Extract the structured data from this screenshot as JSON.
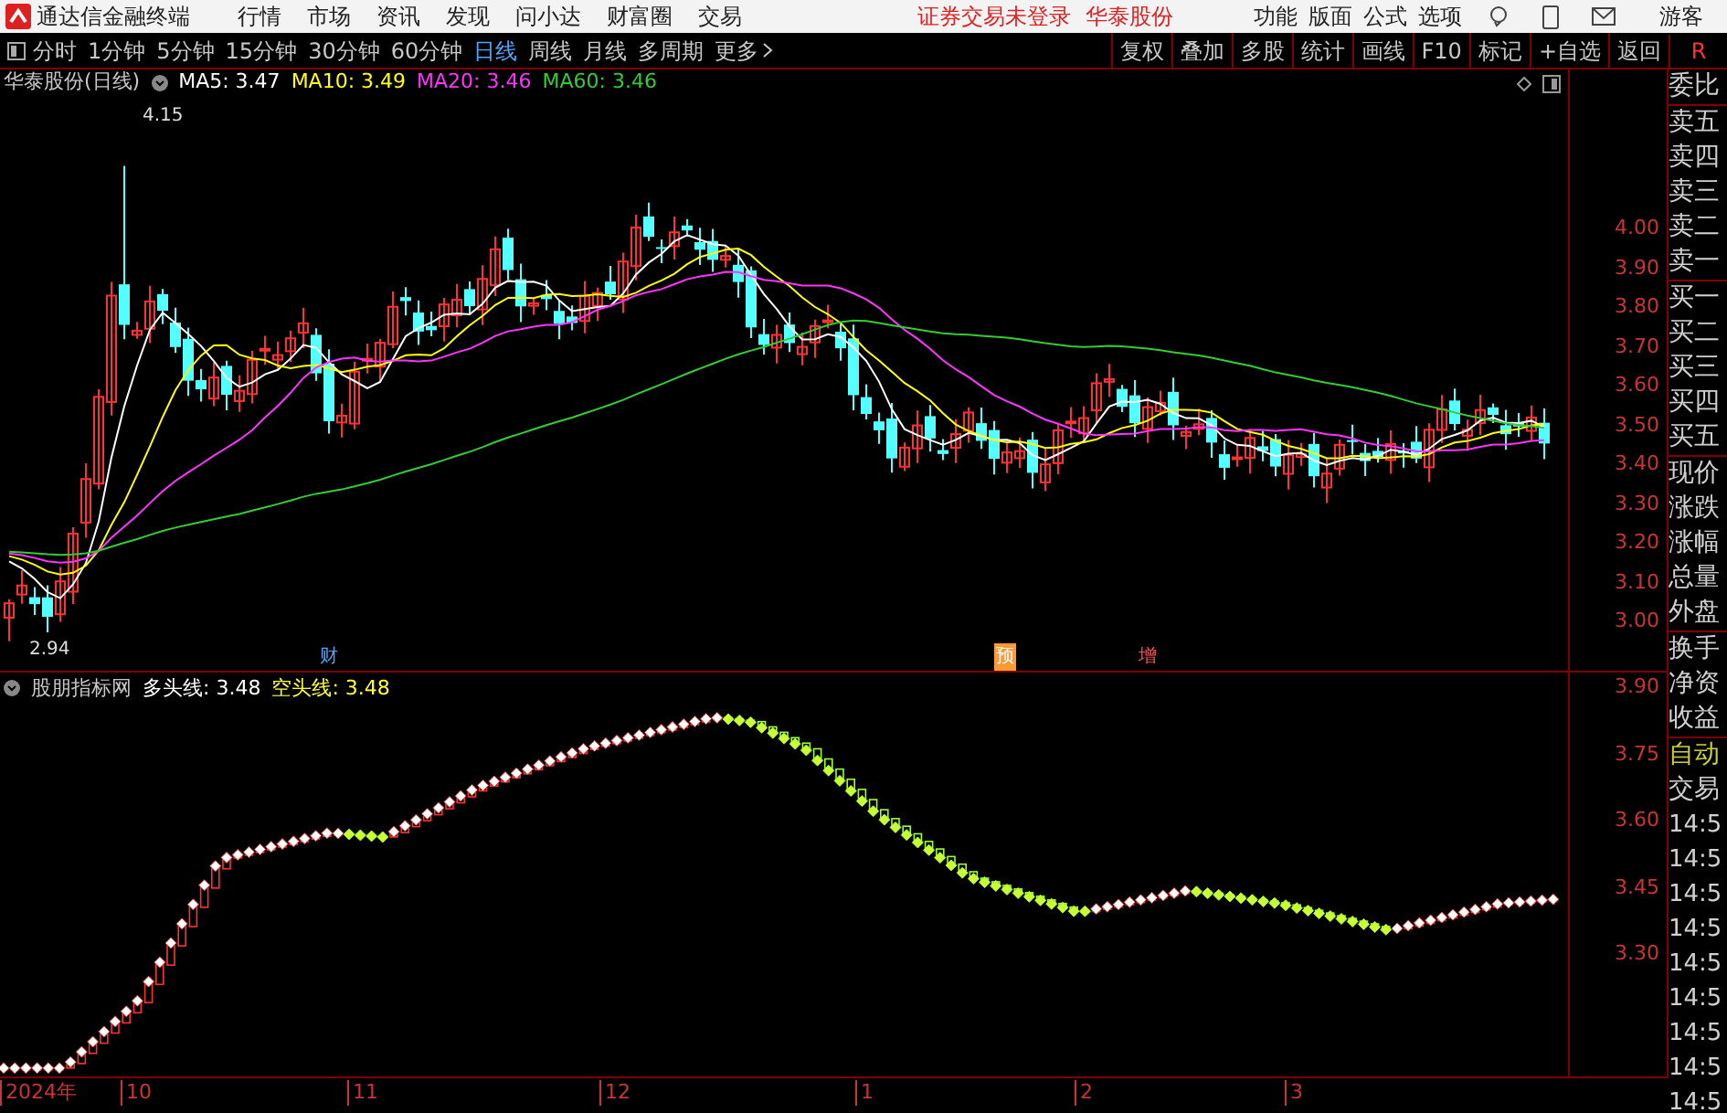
{
  "title_bar": {
    "app_name": "通达信金融终端",
    "menu": [
      "行情",
      "市场",
      "资讯",
      "发现",
      "问小达",
      "财富圈",
      "交易"
    ],
    "notices": [
      "证券交易未登录",
      "华泰股份"
    ],
    "tools": [
      "功能",
      "版面",
      "公式",
      "选项"
    ],
    "user": "游客"
  },
  "period_bar": {
    "periods": [
      {
        "label": "分时",
        "selected": false
      },
      {
        "label": "1分钟",
        "selected": false
      },
      {
        "label": "5分钟",
        "selected": false
      },
      {
        "label": "15分钟",
        "selected": false
      },
      {
        "label": "30分钟",
        "selected": false
      },
      {
        "label": "60分钟",
        "selected": false
      },
      {
        "label": "日线",
        "selected": true
      },
      {
        "label": "周线",
        "selected": false
      },
      {
        "label": "月线",
        "selected": false
      },
      {
        "label": "多周期",
        "selected": false
      }
    ],
    "more": "更多",
    "actions": [
      "复权",
      "叠加",
      "多股",
      "统计",
      "画线",
      "F10",
      "标记",
      "+自选",
      "返回"
    ],
    "corner": "R"
  },
  "price_chart": {
    "title": "华泰股份(日线)",
    "ma": [
      {
        "label": "MA5: 3.47",
        "color": "#ffffff"
      },
      {
        "label": "MA10: 3.49",
        "color": "#ffff00"
      },
      {
        "label": "MA20: 3.46",
        "color": "#ff33ff"
      },
      {
        "label": "MA60: 3.46",
        "color": "#33cc33"
      }
    ],
    "high_label": "4.15",
    "low_label": "2.94",
    "events": [
      {
        "label": "财",
        "color": "#4da6ff"
      },
      {
        "label": "预",
        "color": "#ff9933"
      },
      {
        "label": "增",
        "color": "#ff5555"
      }
    ],
    "axis": [
      "4.00",
      "3.90",
      "3.80",
      "3.70",
      "3.60",
      "3.50",
      "3.40",
      "3.30",
      "3.20",
      "3.10",
      "3.00"
    ]
  },
  "indicator": {
    "title": "股朋指标网",
    "lines": [
      {
        "label": "多头线: 3.48",
        "color": "#ffffff"
      },
      {
        "label": "空头线: 3.48",
        "color": "#ffff33"
      }
    ],
    "axis": [
      "3.90",
      "3.75",
      "3.60",
      "3.45",
      "3.30"
    ]
  },
  "date_axis": [
    "2024年",
    "10",
    "11",
    "12",
    "1",
    "2",
    "3"
  ],
  "quote_panel": {
    "groups": [
      [
        "委比"
      ],
      [
        "卖五",
        "卖四",
        "卖三",
        "卖二",
        "卖一"
      ],
      [
        "买一",
        "买二",
        "买三",
        "买四",
        "买五"
      ],
      [
        "现价",
        "涨跌",
        "涨幅",
        "总量",
        "外盘"
      ],
      [
        "换手",
        "净资",
        "收益"
      ]
    ],
    "auto": "自动",
    "trade": "交易",
    "times": [
      "14:5",
      "14:5",
      "14:5",
      "14:5",
      "14:5",
      "14:5",
      "14:5",
      "14:5",
      "14:5"
    ]
  }
}
